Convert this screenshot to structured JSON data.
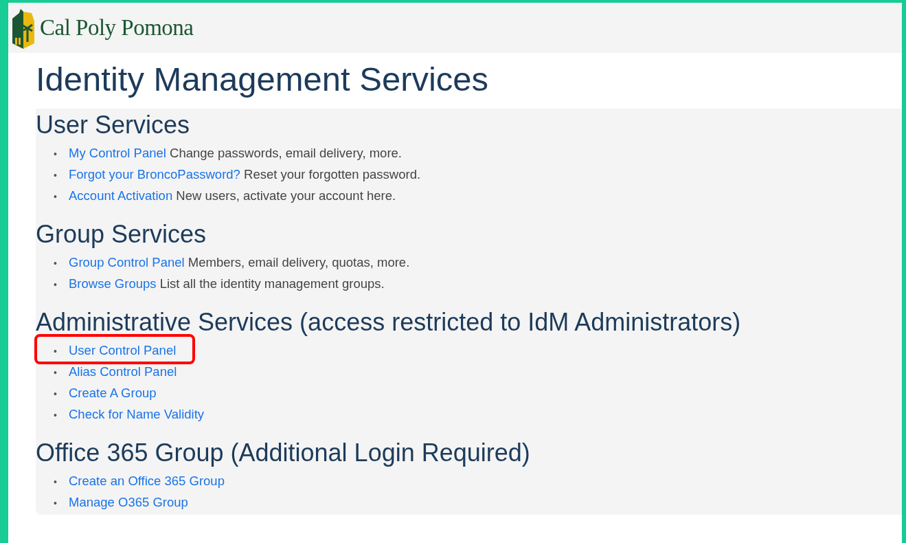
{
  "list_marker": "•",
  "header": {
    "logo_text": "Cal Poly Pomona"
  },
  "title": "Identity Management Services",
  "sections": [
    {
      "heading": "User Services",
      "items": [
        {
          "link": "My Control Panel",
          "description": "Change passwords, email delivery, more.",
          "highlighted": false
        },
        {
          "link": "Forgot your BroncoPassword?",
          "description": "Reset your forgotten password.",
          "highlighted": false
        },
        {
          "link": "Account Activation",
          "description": "New users, activate your account here.",
          "highlighted": false
        }
      ]
    },
    {
      "heading": "Group Services",
      "items": [
        {
          "link": "Group Control Panel",
          "description": "Members, email delivery, quotas, more.",
          "highlighted": false
        },
        {
          "link": "Browse Groups",
          "description": "List all the identity management groups.",
          "highlighted": false
        }
      ]
    },
    {
      "heading": "Administrative Services (access restricted to IdM Administrators)",
      "items": [
        {
          "link": "User Control Panel",
          "highlighted": true
        },
        {
          "link": "Alias Control Panel",
          "highlighted": false
        },
        {
          "link": "Create A Group",
          "highlighted": false
        },
        {
          "link": "Check for Name Validity",
          "highlighted": false
        }
      ]
    },
    {
      "heading": "Office 365 Group (Additional Login Required)",
      "items": [
        {
          "link": "Create an Office 365 Group",
          "highlighted": false
        },
        {
          "link": "Manage O365 Group",
          "highlighted": false
        }
      ]
    }
  ]
}
